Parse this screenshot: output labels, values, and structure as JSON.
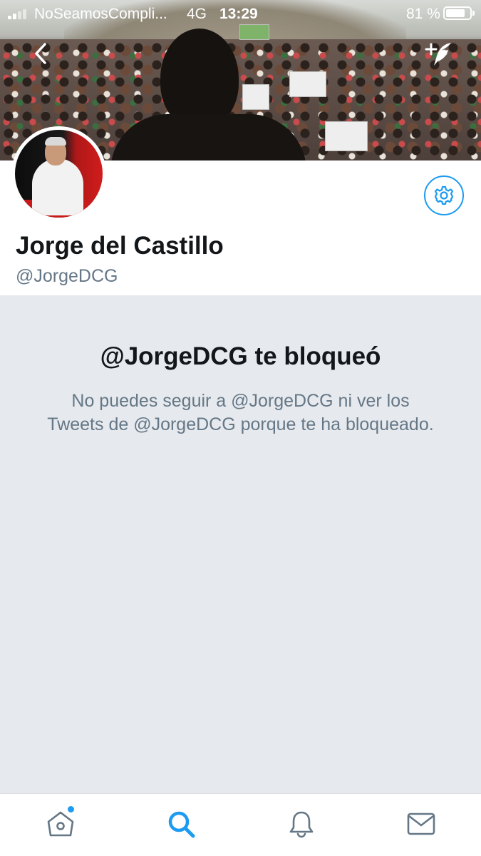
{
  "status_bar": {
    "carrier": "NoSeamosCompli...",
    "network": "4G",
    "time": "13:29",
    "battery_percent": "81 %",
    "battery_level": 0.81
  },
  "header": {
    "back_icon": "chevron-left-icon",
    "compose_icon": "compose-tweet-icon"
  },
  "profile": {
    "display_name": "Jorge del Castillo",
    "handle": "@JorgeDCG",
    "settings_icon": "gear-icon"
  },
  "blocked": {
    "title": "@JorgeDCG te bloqueó",
    "message": "No puedes seguir a @JorgeDCG ni ver los Tweets de @JorgeDCG porque te ha bloqueado."
  },
  "tab_bar": {
    "tabs": [
      {
        "icon": "home-icon",
        "active": false,
        "has_notification_dot": true
      },
      {
        "icon": "search-icon",
        "active": true
      },
      {
        "icon": "bell-icon",
        "active": false
      },
      {
        "icon": "mail-icon",
        "active": false
      }
    ]
  },
  "colors": {
    "accent": "#1d9bf0",
    "panel_background": "#e6e9ed",
    "secondary_text": "#657786",
    "primary_text": "#14171a"
  }
}
